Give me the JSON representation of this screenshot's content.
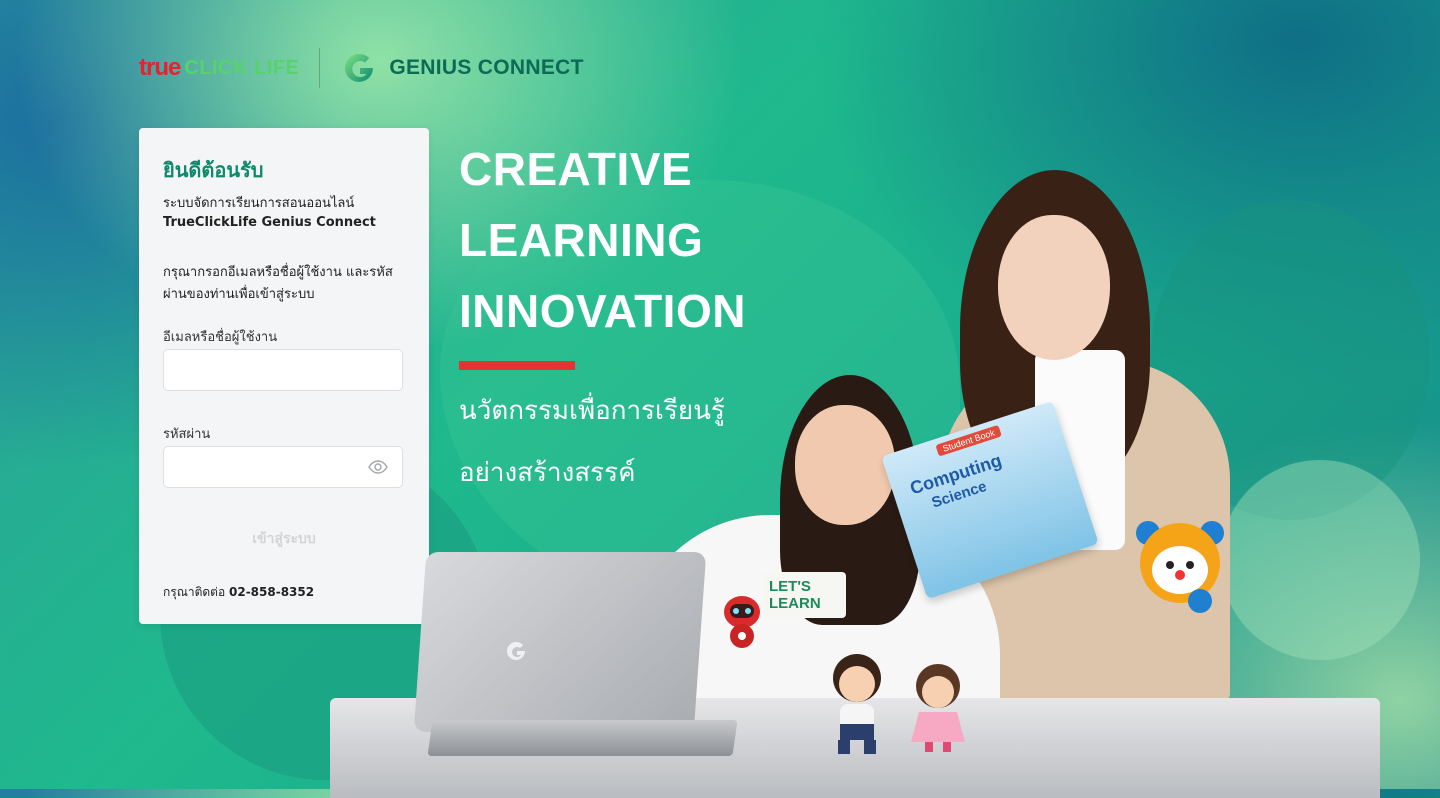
{
  "brand": {
    "true_label": "true",
    "clicklife_label": "CLICK LIFE",
    "genius_label": "GENIUS CONNECT"
  },
  "login": {
    "title": "ยินดีต้อนรับ",
    "subtitle_line1": "ระบบจัดการเรียนการสอนออนไลน์",
    "subtitle_line2": "TrueClickLife Genius Connect",
    "instruction": "กรุณากรอกอีเมลหรือชื่อผู้ใช้งาน และรหัสผ่านของท่านเพื่อเข้าสู่ระบบ",
    "username_label": "อีเมลหรือชื่อผู้ใช้งาน",
    "username_value": "",
    "password_label": "รหัสผ่าน",
    "password_value": "",
    "submit_label": "เข้าสู่ระบบ",
    "contact_prefix": "กรุณาติดต่อ",
    "contact_phone": "02-858-8352"
  },
  "hero": {
    "line1": "CREATIVE",
    "line2": "LEARNING",
    "line3": "INNOVATION",
    "th_line1": "นวัตกรรมเพื่อการเรียนรู้",
    "th_line2": "อย่างสร้างสรรค์"
  },
  "illustration": {
    "book_tag": "Student Book",
    "book_title1": "Computing",
    "book_title2": "Science",
    "sign_line1": "LET'S",
    "sign_line2": "LEARN"
  },
  "colors": {
    "accent_green": "#0e8a6a",
    "accent_red": "#e53232",
    "true_red": "#e8212e"
  }
}
